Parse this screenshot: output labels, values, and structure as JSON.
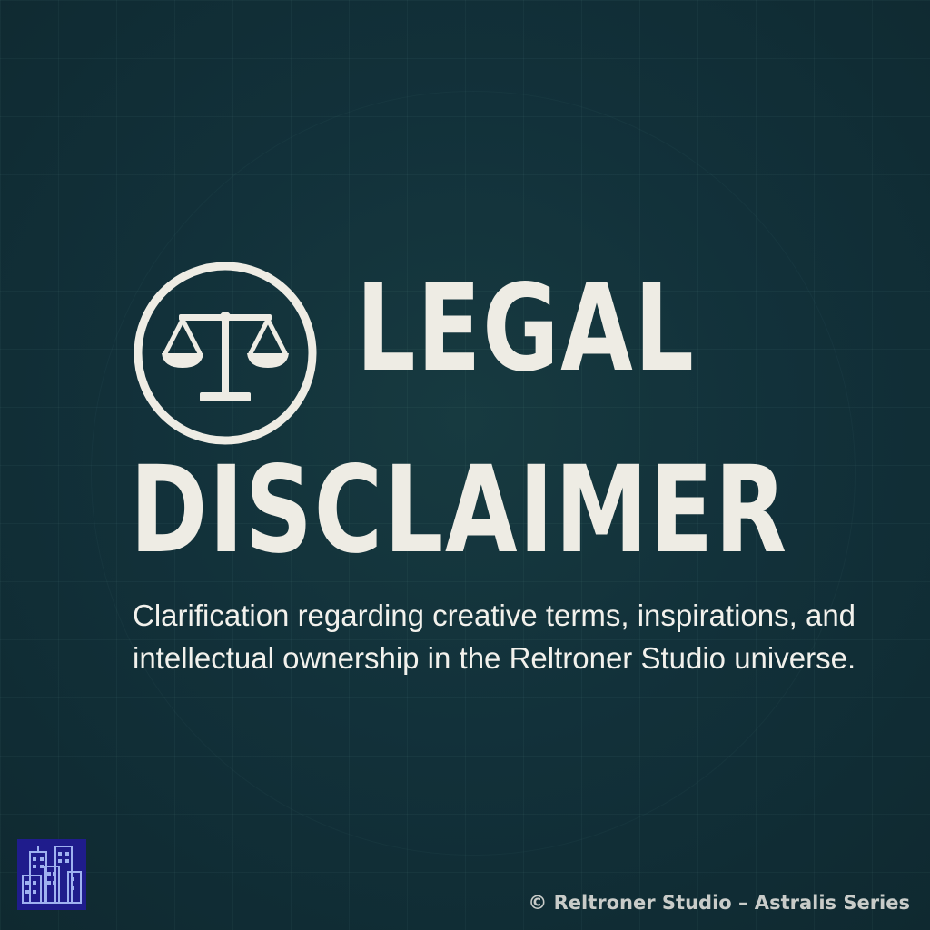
{
  "title": {
    "line1": "LEGAL",
    "line2": "DISCLAIMER"
  },
  "subtitle": "Clarification regarding creative terms, inspirations, and intellectual ownership in the Reltroner Studio universe.",
  "footer": "© Reltroner Studio – Astralis Series",
  "icons": {
    "emblem": "scales-of-justice-icon",
    "logo": "city-buildings-logo"
  },
  "colors": {
    "background": "#12313a",
    "text": "#eeece4",
    "logo_background": "#1f1c8c"
  }
}
